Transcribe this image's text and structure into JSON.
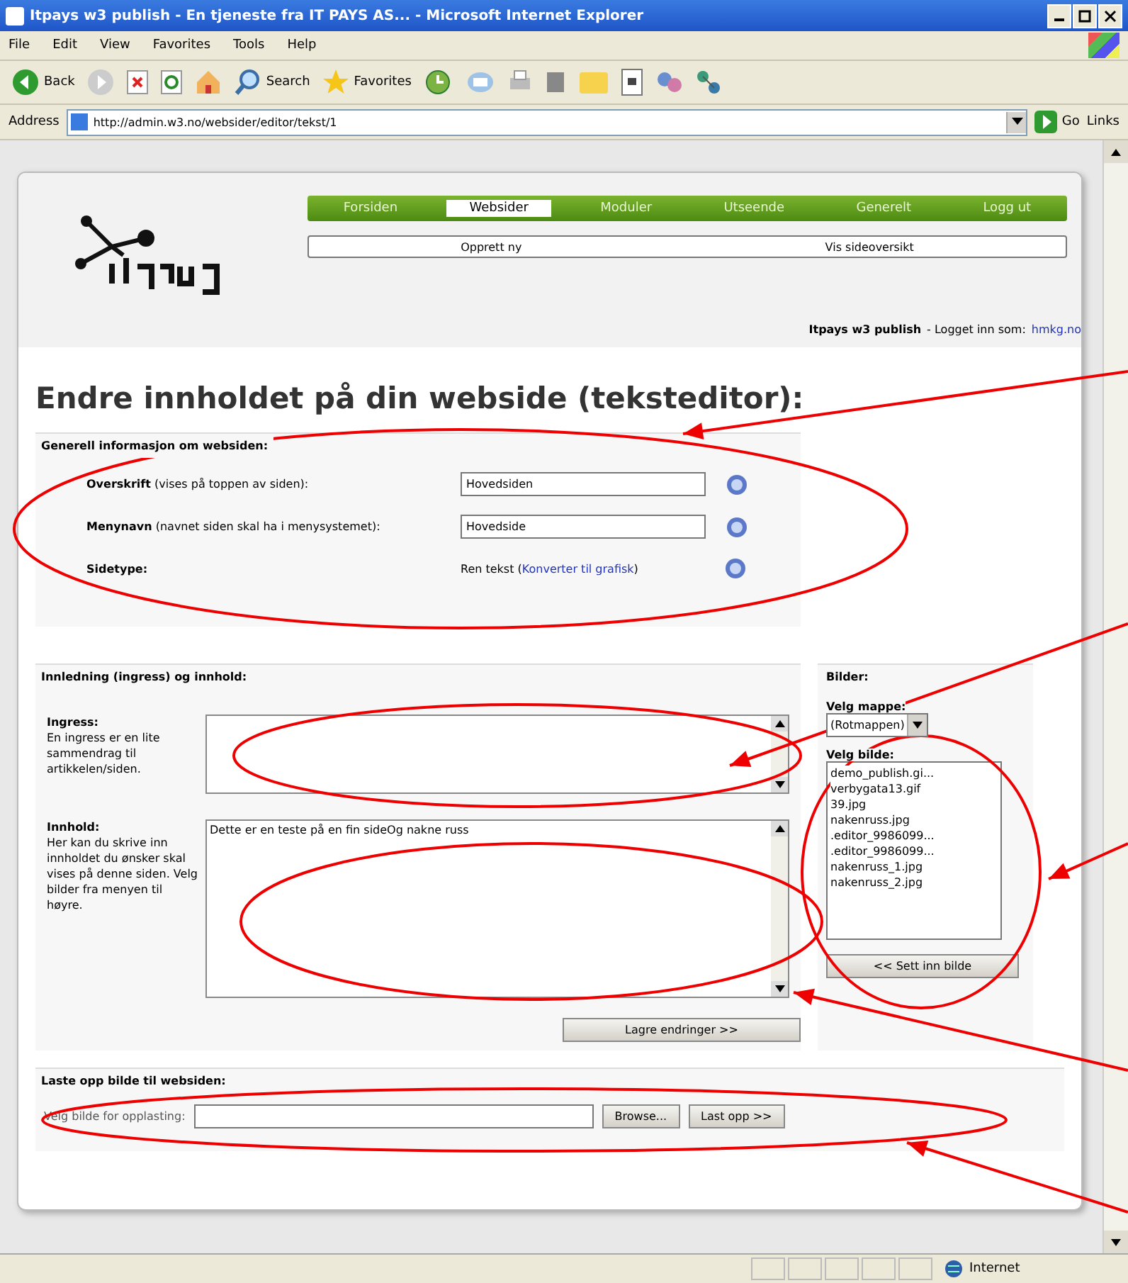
{
  "window": {
    "title": "Itpays w3 publish - En tjeneste fra IT PAYS AS... - Microsoft Internet Explorer"
  },
  "menu": [
    "File",
    "Edit",
    "View",
    "Favorites",
    "Tools",
    "Help"
  ],
  "toolbar": {
    "back": "Back",
    "search": "Search",
    "favorites": "Favorites"
  },
  "address_bar": {
    "label": "Address",
    "url": "http://admin.w3.no/websider/editor/tekst/1",
    "go": "Go",
    "links": "Links"
  },
  "nav": [
    {
      "label": "Forsiden",
      "selected": false
    },
    {
      "label": "Websider",
      "selected": true
    },
    {
      "label": "Moduler",
      "selected": false
    },
    {
      "label": "Utseende",
      "selected": false
    },
    {
      "label": "Generelt",
      "selected": false
    },
    {
      "label": "Logg ut",
      "selected": false
    }
  ],
  "subnav": [
    "Opprett ny",
    "Vis sideoversikt"
  ],
  "login": {
    "product": "Itpays w3 publish",
    "text": "- Logget inn som:",
    "user": "hmkg.no"
  },
  "heading": "Endre innholdet på din webside (teksteditor):",
  "general": {
    "title": "Generell informasjon om websiden:",
    "rows": [
      {
        "kind": "field",
        "label": "Overskrift",
        "hint": "(vises på toppen av siden):",
        "value": "Hovedsiden"
      },
      {
        "kind": "field",
        "label": "Menynavn",
        "hint": "(navnet siden skal ha i menysystemet):",
        "value": "Hovedside"
      },
      {
        "kind": "type",
        "label": "Sidetype:",
        "value": "Ren tekst (",
        "link": "Konverter til grafisk",
        "after": ")"
      }
    ]
  },
  "content": {
    "title": "Innledning (ingress) og innhold:",
    "fields": [
      {
        "label": "Ingress:",
        "help": "En ingress er en lite sammendrag til artikkelen/siden."
      },
      {
        "label": "Innhold:",
        "help": "Her kan du skrive inn innholdet du ønsker skal vises på denne siden. Velg bilder fra menyen til høyre.",
        "value": "Dette er en teste på en fin sideOg nakne russ"
      }
    ],
    "save": "Lagre endringer >>"
  },
  "images": {
    "title": "Bilder:",
    "folder_label": "Velg mappe:",
    "folder": "(Rotmappen)",
    "image_label": "Velg bilde:",
    "files": [
      "demo_publish.gi...",
      "verbygata13.gif",
      "39.jpg",
      "nakenruss.jpg",
      ".editor_9986099...",
      ".editor_9986099...",
      "nakenruss_1.jpg",
      "nakenruss_2.jpg"
    ],
    "insert": "<< Sett inn bilde"
  },
  "upload": {
    "title": "Laste opp bilde til websiden:",
    "label": "Velg bilde for opplasting:",
    "browse": "Browse...",
    "submit": "Last opp >>"
  },
  "status_bar": {
    "zone": "Internet"
  }
}
